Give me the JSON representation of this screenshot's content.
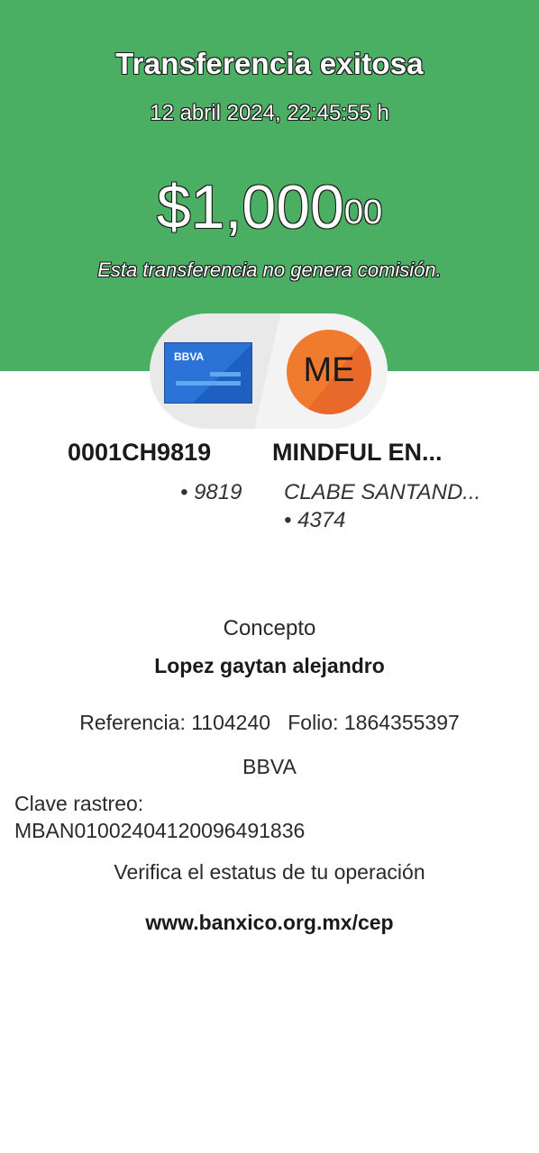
{
  "header": {
    "title": "Transferencia exitosa",
    "date": "12 abril 2024, 22:45:55 h",
    "amount_main": "$1,000",
    "amount_cents": "00",
    "fee_note": "Esta transferencia no genera comisión.",
    "background_color": "#4aaf63"
  },
  "origin": {
    "card_brand": "BBVA",
    "account_name": "0001CH9819",
    "account_digits": "• 9819"
  },
  "destination": {
    "initials": "ME",
    "avatar_color": "#f07a2e",
    "account_name": "MINDFUL EN...",
    "bank_line": "CLABE SANTAND...",
    "account_digits": "• 4374"
  },
  "details": {
    "concept_label": "Concepto",
    "concept_value": "Lopez gaytan alejandro",
    "references": "Referencia: 1104240   Folio: 1864355397",
    "bank": "BBVA",
    "tracking_label": "Clave rastreo:",
    "tracking_value": "MBAN01002404120096491836",
    "verify_text": "Verifica el estatus de tu operación",
    "verify_url": "www.banxico.org.mx/cep"
  }
}
